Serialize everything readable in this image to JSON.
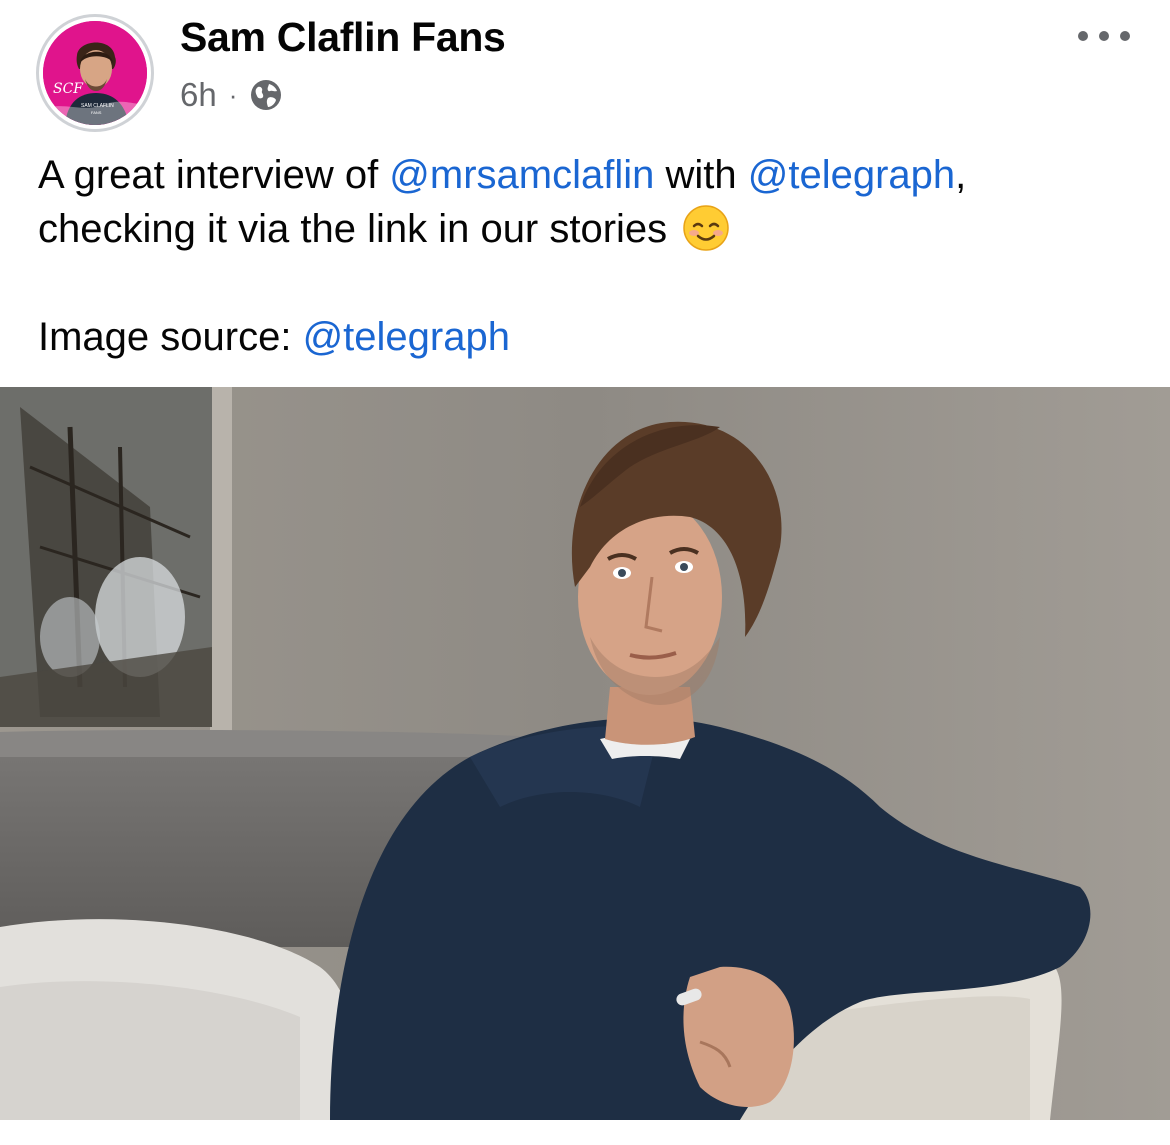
{
  "post": {
    "author_name": "Sam Claflin Fans",
    "timestamp": "6h",
    "separator": "·",
    "privacy_icon": "globe-icon",
    "more_icon": "more-horizontal-icon",
    "avatar_logo": {
      "monogram": "SCF",
      "caption_line1": "SAM CLAFLIN",
      "caption_line2": "FANS"
    },
    "text": {
      "line1_prefix": "A great interview of ",
      "mention1": "@mrsamclaflin",
      "line1_middle": " with ",
      "mention2": "@telegraph",
      "line1_suffix": ",",
      "line2": "checking it via the link in our stories",
      "emoji": "☺️",
      "source_label": "Image source: ",
      "source_mention": "@telegraph"
    },
    "colors": {
      "link": "#1a66d2",
      "avatar_bg": "#e0148c",
      "meta": "#65676b"
    }
  }
}
